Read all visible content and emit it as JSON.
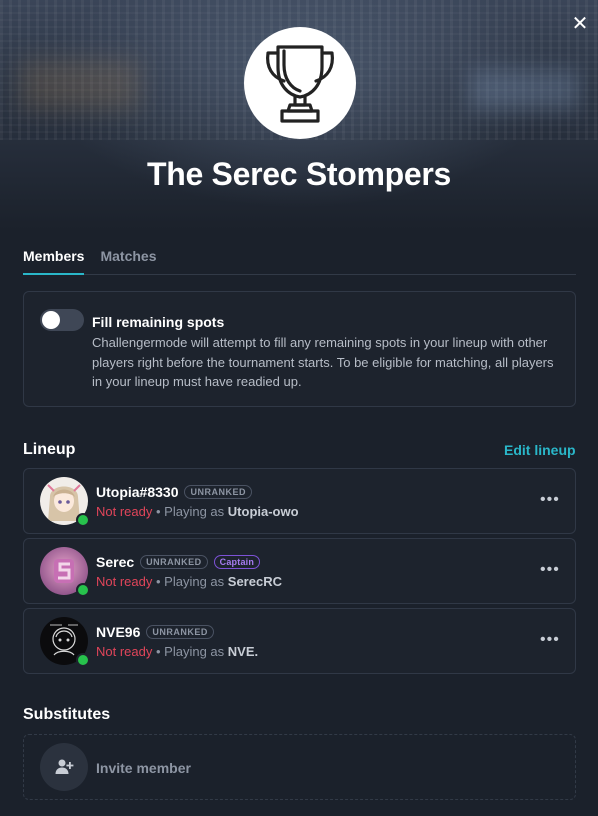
{
  "close_label": "✕",
  "team": {
    "name": "The Serec Stompers"
  },
  "tabs": [
    {
      "label": "Members",
      "active": true
    },
    {
      "label": "Matches",
      "active": false
    }
  ],
  "fill_spots": {
    "title": "Fill remaining spots",
    "enabled": false,
    "description": "Challengermode will attempt to fill any remaining spots in your lineup with other players right before the tournament starts. To be eligible for matching, all players in your lineup must have readied up."
  },
  "lineup": {
    "title": "Lineup",
    "edit_label": "Edit lineup",
    "players": [
      {
        "name": "Utopia#8330",
        "rank_badge": "UNRANKED",
        "role_badge": "",
        "status": "Not ready",
        "playing_prefix": "• Playing as",
        "playing_as": "Utopia-owo",
        "menu": "•••"
      },
      {
        "name": "Serec",
        "rank_badge": "UNRANKED",
        "role_badge": "Captain",
        "status": "Not ready",
        "playing_prefix": "• Playing as",
        "playing_as": "SerecRC",
        "menu": "•••"
      },
      {
        "name": "NVE96",
        "rank_badge": "UNRANKED",
        "role_badge": "",
        "status": "Not ready",
        "playing_prefix": "• Playing as",
        "playing_as": "NVE.",
        "menu": "•••"
      }
    ]
  },
  "substitutes": {
    "title": "Substitutes",
    "invite_label": "Invite member"
  },
  "icons": {
    "close": "close-icon",
    "trophy": "trophy-icon",
    "invite": "add-user-icon",
    "more": "more-options-icon"
  },
  "colors": {
    "accent": "#2ab7c9",
    "not_ready": "#e0455a",
    "online": "#27c24c",
    "captain": "#a67cf0"
  }
}
